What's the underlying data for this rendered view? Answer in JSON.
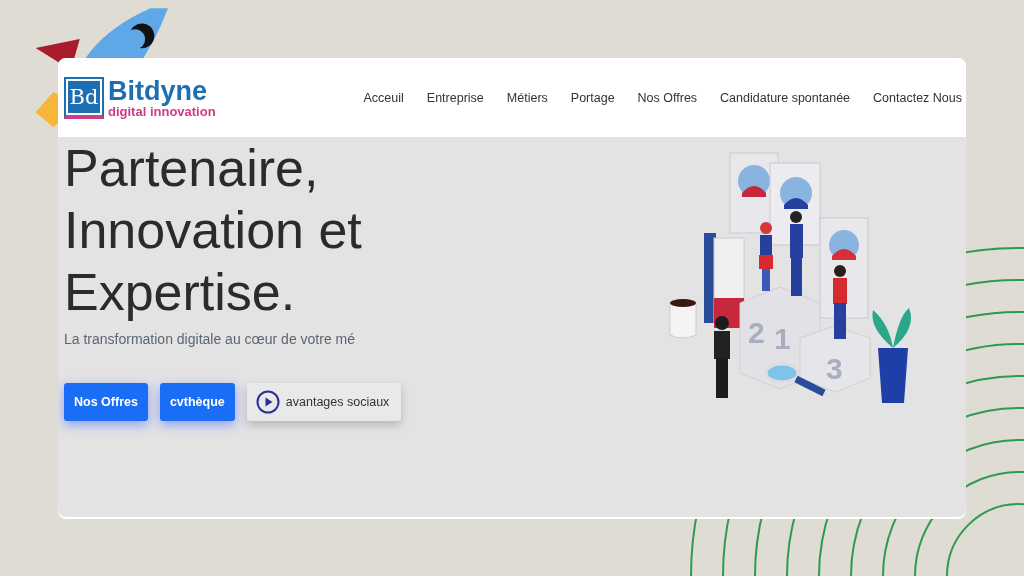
{
  "logo": {
    "monogram": "Bd",
    "name": "Bitdyne",
    "tagline": "digital innovation"
  },
  "nav": [
    {
      "label": "Acceuil"
    },
    {
      "label": "Entreprise"
    },
    {
      "label": "Métiers"
    },
    {
      "label": "Portage"
    },
    {
      "label": "Nos Offres"
    },
    {
      "label": "Candidature spontanée"
    },
    {
      "label": "Contactez Nous"
    }
  ],
  "hero": {
    "title_lines": [
      "Partenaire,",
      "Innovation et",
      "Expertise."
    ],
    "subtitle": "La transformation digitale au cœur de votre mé",
    "buttons": [
      {
        "label": "Nos Offres",
        "kind": "primary"
      },
      {
        "label": "cvthèque",
        "kind": "primary"
      },
      {
        "label": "avantages sociaux",
        "kind": "video"
      }
    ]
  },
  "illustration": {
    "podium_numbers": [
      "2",
      "1",
      "3"
    ]
  }
}
